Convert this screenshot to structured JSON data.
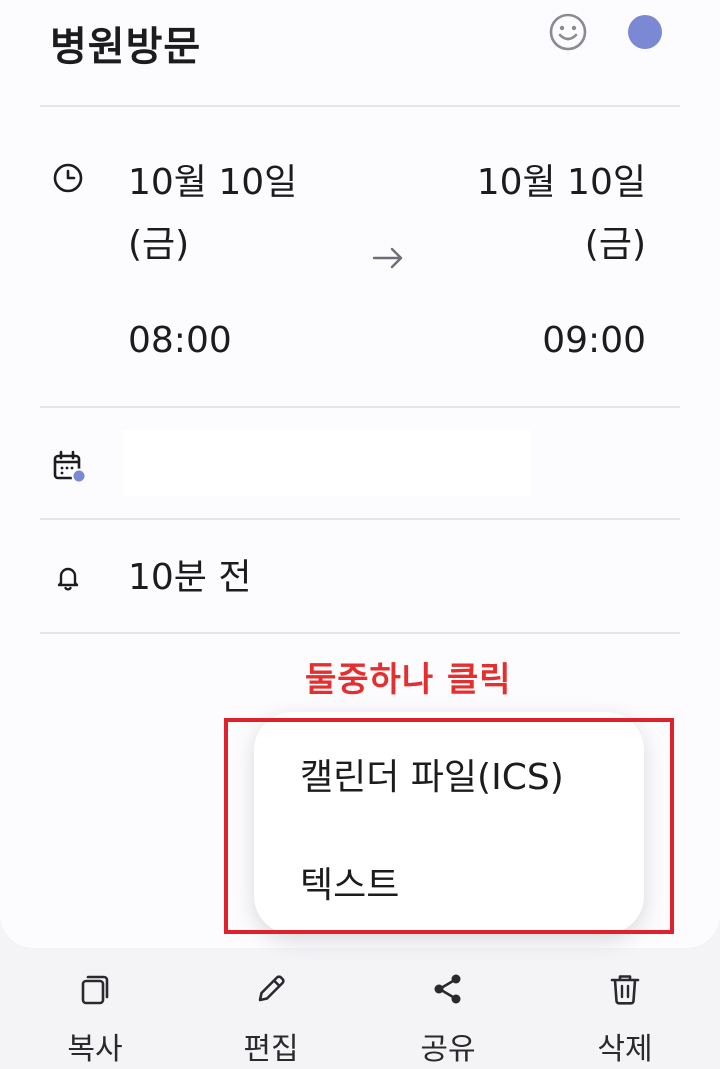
{
  "event": {
    "title": "병원방문",
    "color": "#7b88d4",
    "start": {
      "date": "10월 10일",
      "weekday": "(금)",
      "time": "08:00"
    },
    "end": {
      "date": "10월 10일",
      "weekday": "(금)",
      "time": "09:00"
    },
    "calendar_value": "",
    "reminder": "10분 전"
  },
  "annotation": {
    "text": "둘중하나 클릭",
    "color": "#e52e2e"
  },
  "share_menu": {
    "items": [
      {
        "label": "캘린더 파일(ICS)"
      },
      {
        "label": "텍스트"
      }
    ]
  },
  "toolbar": {
    "copy_label": "복사",
    "edit_label": "편집",
    "share_label": "공유",
    "delete_label": "삭제"
  },
  "icons": [
    "smiley-icon",
    "clock-icon",
    "arrow-right-icon",
    "calendar-icon",
    "bell-icon",
    "copy-icon",
    "pencil-icon",
    "share-icon",
    "trash-icon"
  ]
}
